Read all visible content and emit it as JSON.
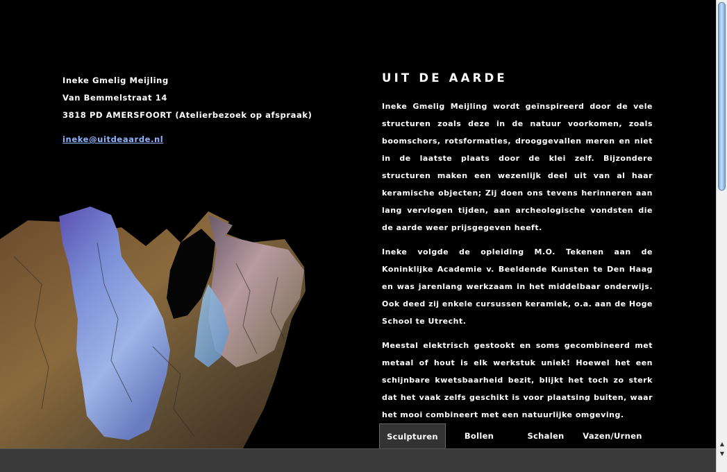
{
  "contact": {
    "name": "Ineke Gmelig Meijling",
    "street": "Van Bemmelstraat 14",
    "city": "3818 PD AMERSFOORT (Atelierbezoek op afspraak)",
    "email": "ineke@uitdeaarde.nl"
  },
  "title": "UIT DE AARDE",
  "paragraphs": [
    "Ineke Gmelig Meijling wordt geïnspireerd door de vele structuren zoals deze in de natuur voorkomen, zoals boomschors, rotsformaties, drooggevallen meren en niet in de laatste plaats door de klei zelf. Bijzondere structuren maken een wezenlijk deel uit van al haar keramische objecten; Zij doen ons tevens herinneren aan lang vervlogen tijden, aan archeologische vondsten die de aarde weer prijsgegeven heeft.",
    "Ineke volgde de opleiding M.O. Tekenen aan de Koninklijke Academie v. Beeldende Kunsten te Den Haag en was jarenlang werkzaam in het middelbaar onderwijs. Ook deed zij enkele cursussen keramiek, o.a. aan de Hoge School te Utrecht.",
    "Meestal elektrisch gestookt en soms gecombineerd met metaal of hout is elk werkstuk uniek! Hoewel het een schijnbare kwetsbaarheid bezit, blijkt het toch zo sterk dat het vaak zelfs geschikt is voor plaatsing buiten, waar het mooi combineert met een natuurlijke omgeving."
  ],
  "tabs": [
    {
      "label": "Sculpturen",
      "active": true
    },
    {
      "label": "Bollen",
      "active": false
    },
    {
      "label": "Schalen",
      "active": false
    },
    {
      "label": "Vazen/Urnen",
      "active": false
    }
  ],
  "scrollbar": {
    "up_icon": "▲",
    "down_icon": "▼"
  }
}
